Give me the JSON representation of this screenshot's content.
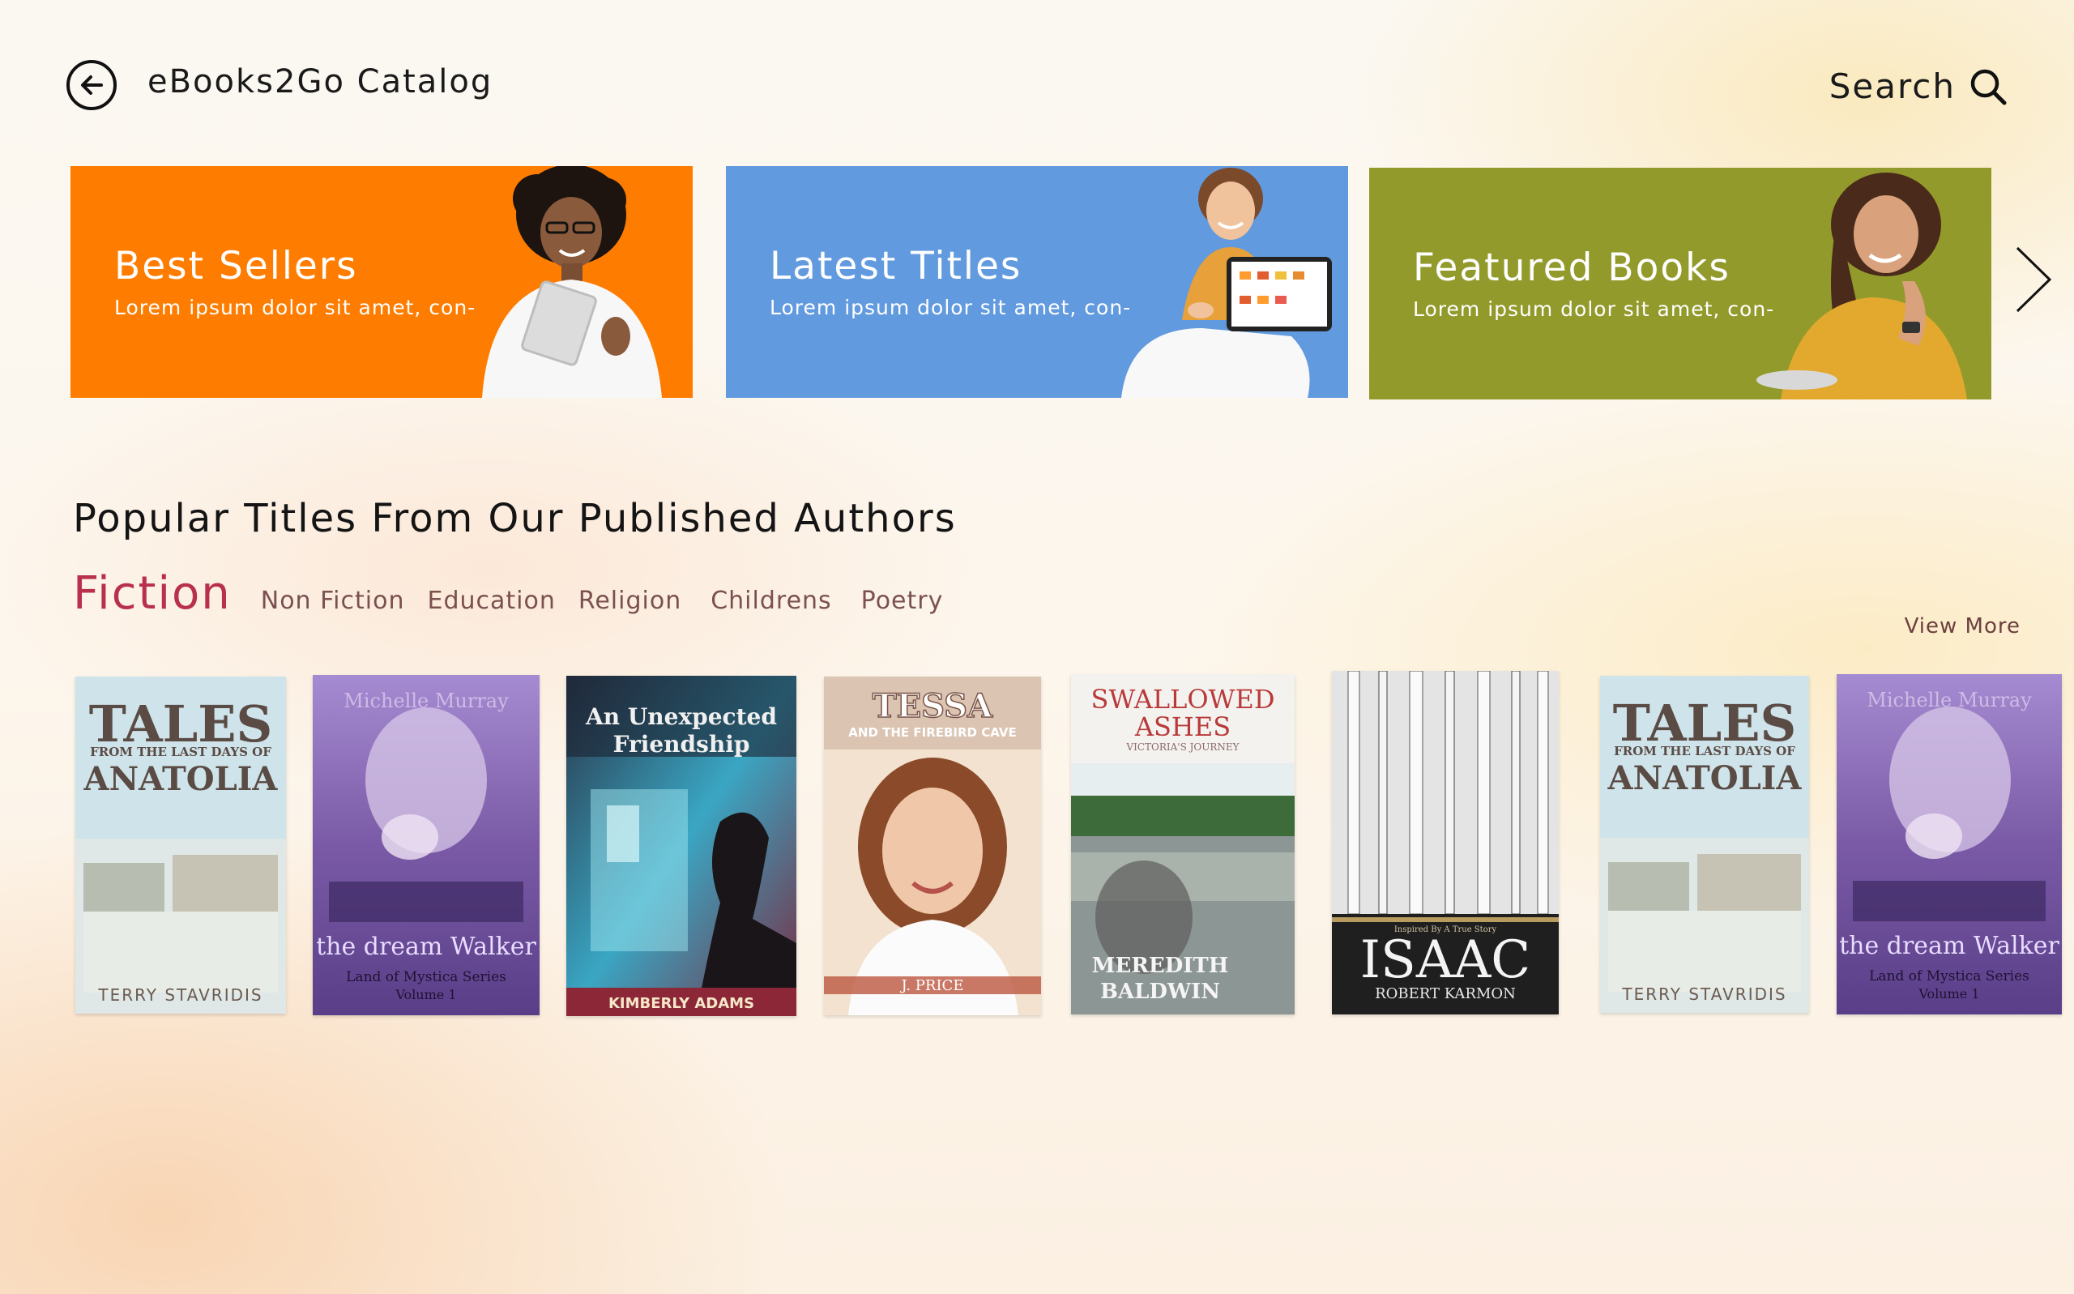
{
  "header": {
    "title": "eBooks2Go Catalog",
    "search_label": "Search"
  },
  "banners": [
    {
      "title": "Best Sellers",
      "subtitle": "Lorem ipsum dolor sit amet, con-",
      "color": "#fe7c00"
    },
    {
      "title": "Latest Titles",
      "subtitle": "Lorem ipsum dolor sit amet, con-",
      "color": "#619ade"
    },
    {
      "title": "Featured Books",
      "subtitle": "Lorem ipsum dolor sit amet, con-",
      "color": "#939a2c"
    }
  ],
  "section": {
    "title": "Popular Titles From Our Published Authors",
    "view_more": "View More"
  },
  "tabs": [
    {
      "label": "Fiction",
      "active": true
    },
    {
      "label": "Non Fiction"
    },
    {
      "label": "Education"
    },
    {
      "label": "Religion"
    },
    {
      "label": "Childrens"
    },
    {
      "label": "Poetry"
    }
  ],
  "books": [
    {
      "title": "TALES",
      "subtitle": "FROM THE LAST DAYS OF",
      "title2": "ANATOLIA",
      "author": "TERRY STAVRIDIS"
    },
    {
      "title": "the dream Walker",
      "series": "Land of Mystica Series",
      "volume": "Volume 1",
      "author": "Michelle Murray"
    },
    {
      "title": "An Unexpected",
      "title2": "Friendship",
      "author": "KIMBERLY ADAMS"
    },
    {
      "title": "TESSA",
      "subtitle": "AND THE FIREBIRD CAVE",
      "author": "J. PRICE"
    },
    {
      "title": "SWALLOWED",
      "title2": "ASHES",
      "subtitle": "VICTORIA'S JOURNEY",
      "author": "MEREDITH",
      "author2": "BALDWIN"
    },
    {
      "title": "ISAAC",
      "tagline": "Inspired By A True Story",
      "author": "ROBERT KARMON"
    },
    {
      "title": "TALES",
      "subtitle": "FROM THE LAST DAYS OF",
      "title2": "ANATOLIA",
      "author": "TERRY STAVRIDIS"
    },
    {
      "title": "the dream Walker",
      "series": "Land of Mystica Series",
      "volume": "Volume 1",
      "author": "Michelle Murray"
    }
  ]
}
